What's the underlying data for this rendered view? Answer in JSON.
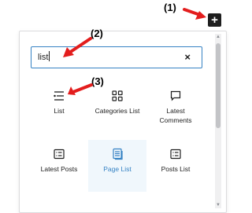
{
  "toolbar": {
    "add_block_glyph": "+"
  },
  "annotations": {
    "one": "(1)",
    "two": "(2)",
    "three": "(3)",
    "arrow_color": "#e31d1d"
  },
  "inserter": {
    "search": {
      "value": "list",
      "clear_glyph": "×"
    },
    "blocks": [
      {
        "label": "List",
        "icon": "list-icon"
      },
      {
        "label": "Categories List",
        "icon": "categories-grid-icon"
      },
      {
        "label": "Latest\nComments",
        "icon": "comment-icon"
      },
      {
        "label": "Latest Posts",
        "icon": "latest-posts-icon"
      },
      {
        "label": "Page List",
        "icon": "page-list-icon",
        "selected": true
      },
      {
        "label": "Posts List",
        "icon": "posts-list-icon"
      }
    ]
  }
}
